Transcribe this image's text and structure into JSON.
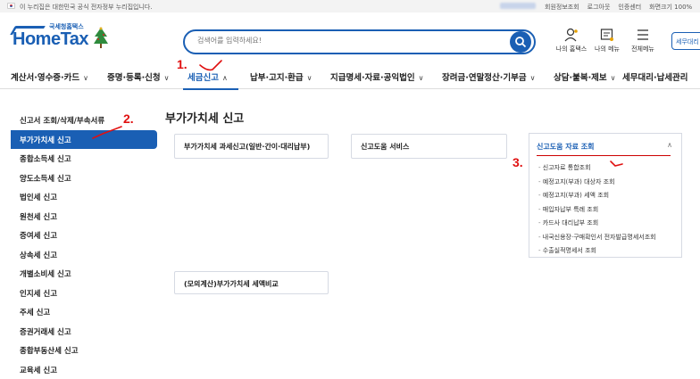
{
  "topbar": {
    "notice": "이 누리집은 대한민국 공식 전자정부 누리집입니다.",
    "links": [
      "회원정보조회",
      "로그아웃",
      "인증센터",
      "화면크기 100%"
    ]
  },
  "header": {
    "logo_small": "국세청홈택스",
    "logo": "HomeTax",
    "search_placeholder": "검색어를 입력하세요!",
    "util": [
      {
        "label": "나의 홈택스",
        "icon": "person-icon"
      },
      {
        "label": "나의 메뉴",
        "icon": "menu-card-icon"
      },
      {
        "label": "전체메뉴",
        "icon": "hamburger-icon"
      }
    ],
    "all_menu_box": "세무대리"
  },
  "nav": {
    "items": [
      "계산서·영수증·카드",
      "증명·등록·신청",
      "세금신고",
      "납부·고지·환급",
      "지급명세·자료·공익법인",
      "장려금·연말정산·기부금",
      "상담·불복·제보",
      "세무대리·납세관리"
    ],
    "active_index": 2
  },
  "sidebar": {
    "items": [
      "신고서 조회/삭제/부속서류",
      "부가가치세 신고",
      "종합소득세 신고",
      "양도소득세 신고",
      "법인세 신고",
      "원천세 신고",
      "증여세 신고",
      "상속세 신고",
      "개별소비세 신고",
      "인지세 신고",
      "주세 신고",
      "증권거래세 신고",
      "종합부동산세 신고",
      "교육세 신고"
    ],
    "active_index": 1
  },
  "main": {
    "title": "부가가치세 신고",
    "card1": "부가가치세 과세신고(일반·간이·대리납부)",
    "card2": "신고도움 서비스",
    "card3": "(모의계산)부가가치세 세액비교",
    "expand": {
      "title": "신고도움 자료 조회",
      "items": [
        "신고자료 통합조회",
        "예정고지(부과) 대상자 조회",
        "예정고지(부과) 세액 조회",
        "매입자납부 특례 조회",
        "카드사 대리납부 조회",
        "내국신용장·구매확인서 전자발급명세서조회",
        "수출실적명세서 조회"
      ]
    }
  },
  "annotations": [
    "1.",
    "2.",
    "3."
  ],
  "colors": {
    "accent": "#1a5fb4",
    "annotation": "#e01010"
  }
}
